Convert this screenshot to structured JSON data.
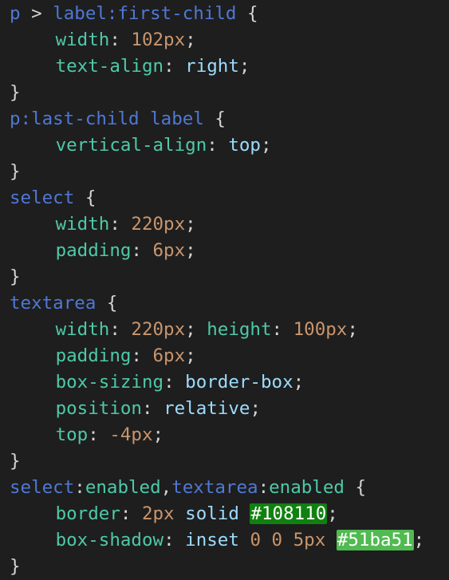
{
  "colors": {
    "background": "#1e1e1e",
    "selector": "#4f78d6",
    "property": "#4ec9a8",
    "number": "#c9956d",
    "keyword": "#9cdcfe",
    "punctuation": "#d4d4d4",
    "swatch_1": "#108110",
    "swatch_2": "#51ba51"
  },
  "lines": [
    [
      [
        "sel",
        "p"
      ],
      [
        "punct",
        " > "
      ],
      [
        "sel",
        "label"
      ],
      [
        "sel",
        ":first-child"
      ],
      [
        "punct",
        " {"
      ]
    ],
    [
      [
        "indent",
        ""
      ],
      [
        "prop",
        "width"
      ],
      [
        "punct",
        ": "
      ],
      [
        "num",
        "102px"
      ],
      [
        "punct",
        ";"
      ]
    ],
    [
      [
        "indent",
        ""
      ],
      [
        "prop",
        "text-align"
      ],
      [
        "punct",
        ": "
      ],
      [
        "kw",
        "right"
      ],
      [
        "punct",
        ";"
      ]
    ],
    [
      [
        "punct",
        "}"
      ]
    ],
    [
      [
        "sel",
        "p"
      ],
      [
        "sel",
        ":last-child"
      ],
      [
        "punct",
        " "
      ],
      [
        "sel",
        "label"
      ],
      [
        "punct",
        " {"
      ]
    ],
    [
      [
        "indent",
        ""
      ],
      [
        "prop",
        "vertical-align"
      ],
      [
        "punct",
        ": "
      ],
      [
        "kw",
        "top"
      ],
      [
        "punct",
        ";"
      ]
    ],
    [
      [
        "punct",
        "}"
      ]
    ],
    [
      [
        "sel",
        "select"
      ],
      [
        "punct",
        " {"
      ]
    ],
    [
      [
        "indent",
        ""
      ],
      [
        "prop",
        "width"
      ],
      [
        "punct",
        ": "
      ],
      [
        "num",
        "220px"
      ],
      [
        "punct",
        ";"
      ]
    ],
    [
      [
        "indent",
        ""
      ],
      [
        "prop",
        "padding"
      ],
      [
        "punct",
        ": "
      ],
      [
        "num",
        "6px"
      ],
      [
        "punct",
        ";"
      ]
    ],
    [
      [
        "punct",
        "}"
      ]
    ],
    [
      [
        "sel",
        "textarea"
      ],
      [
        "punct",
        " {"
      ]
    ],
    [
      [
        "indent",
        ""
      ],
      [
        "prop",
        "width"
      ],
      [
        "punct",
        ": "
      ],
      [
        "num",
        "220px"
      ],
      [
        "punct",
        "; "
      ],
      [
        "prop",
        "height"
      ],
      [
        "punct",
        ": "
      ],
      [
        "num",
        "100px"
      ],
      [
        "punct",
        ";"
      ]
    ],
    [
      [
        "indent",
        ""
      ],
      [
        "prop",
        "padding"
      ],
      [
        "punct",
        ": "
      ],
      [
        "num",
        "6px"
      ],
      [
        "punct",
        ";"
      ]
    ],
    [
      [
        "indent",
        ""
      ],
      [
        "prop",
        "box-sizing"
      ],
      [
        "punct",
        ": "
      ],
      [
        "kw",
        "border-box"
      ],
      [
        "punct",
        ";"
      ]
    ],
    [
      [
        "indent",
        ""
      ],
      [
        "prop",
        "position"
      ],
      [
        "punct",
        ": "
      ],
      [
        "kw",
        "relative"
      ],
      [
        "punct",
        ";"
      ]
    ],
    [
      [
        "indent",
        ""
      ],
      [
        "prop",
        "top"
      ],
      [
        "punct",
        ": "
      ],
      [
        "num",
        "-4px"
      ],
      [
        "punct",
        ";"
      ]
    ],
    [
      [
        "punct",
        "}"
      ]
    ],
    [
      [
        "sel",
        "select"
      ],
      [
        "punct",
        ":"
      ],
      [
        "prop",
        "enabled"
      ],
      [
        "punct",
        ","
      ],
      [
        "sel",
        "textarea"
      ],
      [
        "punct",
        ":"
      ],
      [
        "prop",
        "enabled"
      ],
      [
        "punct",
        " {"
      ]
    ],
    [
      [
        "indent",
        ""
      ],
      [
        "prop",
        "border"
      ],
      [
        "punct",
        ": "
      ],
      [
        "num",
        "2px"
      ],
      [
        "punct",
        " "
      ],
      [
        "kw",
        "solid"
      ],
      [
        "punct",
        " "
      ],
      [
        "swatch1",
        "#108110"
      ],
      [
        "punct",
        ";"
      ]
    ],
    [
      [
        "indent",
        ""
      ],
      [
        "prop",
        "box-shadow"
      ],
      [
        "punct",
        ": "
      ],
      [
        "kw",
        "inset"
      ],
      [
        "punct",
        " "
      ],
      [
        "num",
        "0"
      ],
      [
        "punct",
        " "
      ],
      [
        "num",
        "0"
      ],
      [
        "punct",
        " "
      ],
      [
        "num",
        "5px"
      ],
      [
        "punct",
        " "
      ],
      [
        "swatch2",
        "#51ba51"
      ],
      [
        "punct",
        ";"
      ]
    ],
    [
      [
        "punct",
        "}"
      ]
    ]
  ]
}
